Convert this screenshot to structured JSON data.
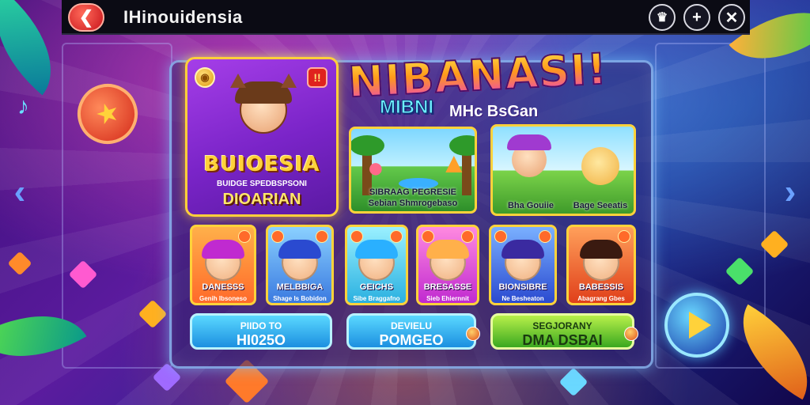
{
  "header": {
    "back_icon": "chevron-left-icon",
    "title": "IHinouidensia",
    "icons": [
      "trophy-icon",
      "plus-icon",
      "close-icon"
    ]
  },
  "logo": {
    "main": "NIBANASI!",
    "sub1": "MIBNI",
    "sub2": "MHc BsGan"
  },
  "featured": {
    "badge_right": "!!",
    "title": "BUIOESIA",
    "subtitle": "BUIDGE SPEDBSPSONI",
    "subtitle2": "DIOARIAN"
  },
  "scenes": [
    {
      "label_top": "SIBRAAG  PEGRESIE",
      "label_bottom": "Sebian Shmrogebaso"
    },
    {
      "label_left": "Bha Gouiie",
      "label_right": "Bage Seeatis"
    }
  ],
  "characters": [
    {
      "name": "DANESSS",
      "caption": "Genih Ibsoneso",
      "hair": "#c02ad0",
      "bg": "#ff8a3a"
    },
    {
      "name": "MELBBIGA",
      "caption": "Shage Is Bobidon",
      "hair": "#2a4ad0",
      "bg": "#4a9aff"
    },
    {
      "name": "GEICHS",
      "caption": "Sibe Braggafno",
      "hair": "#2ab0ff",
      "bg": "#5ad8ff"
    },
    {
      "name": "BRESASSE",
      "caption": "Sieb Ehiernnit",
      "hair": "#ffb04a",
      "bg": "#e04ad8"
    },
    {
      "name": "BIONSIBRE",
      "caption": "Ne Besheaton",
      "hair": "#3a2aa0",
      "bg": "#3a6ae0"
    },
    {
      "name": "BABESSIS",
      "caption": "Abagrang Gbes",
      "hair": "#3a1a10",
      "bg": "#ff6a2a"
    }
  ],
  "buttons": [
    {
      "line1": "PIIDO TO",
      "line2": "HI025O"
    },
    {
      "line1": "DEVIELU",
      "line2": "POMGEO"
    },
    {
      "line1": "SEGJORANY",
      "line2": "DMA DSBAI"
    }
  ],
  "play_icon": "play-icon",
  "colors": {
    "frame": "#ffd23a",
    "panel_border": "#96c8ff",
    "back_button": "#c9141b",
    "play_button": "#1a3aa8"
  }
}
